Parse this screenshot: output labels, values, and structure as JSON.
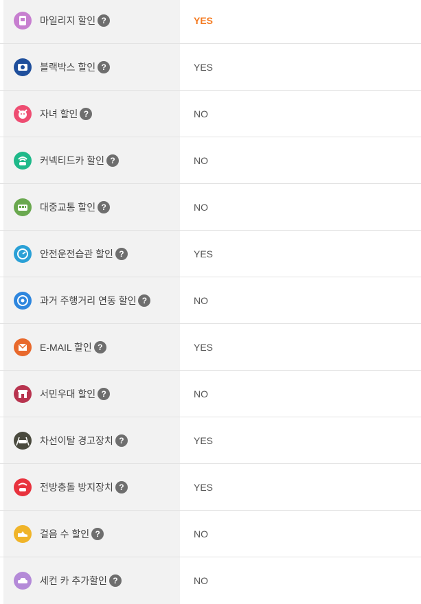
{
  "colors": {
    "highlight": "#f47a20",
    "label_bg": "#f2f2f2",
    "help_bg": "#6e6e6e"
  },
  "discounts": [
    {
      "label": "마일리지 할인",
      "value": "YES",
      "highlight": true,
      "icon": "mileage-icon",
      "color": "#c77fd0"
    },
    {
      "label": "블랙박스 할인",
      "value": "YES",
      "highlight": false,
      "icon": "blackbox-icon",
      "color": "#1f4f9c"
    },
    {
      "label": "자녀 할인",
      "value": "NO",
      "highlight": false,
      "icon": "child-icon",
      "color": "#ee4d72"
    },
    {
      "label": "커넥티드카 할인",
      "value": "NO",
      "highlight": false,
      "icon": "connected-car-icon",
      "color": "#1fb98a"
    },
    {
      "label": "대중교통 할인",
      "value": "NO",
      "highlight": false,
      "icon": "bus-icon",
      "color": "#6aa84f"
    },
    {
      "label": "안전운전습관 할인",
      "value": "YES",
      "highlight": false,
      "icon": "speedometer-icon",
      "color": "#2aa0d6"
    },
    {
      "label": "과거 주행거리 연동 할인",
      "value": "NO",
      "highlight": false,
      "icon": "odometer-icon",
      "color": "#2e86de"
    },
    {
      "label": "E-MAIL 할인",
      "value": "YES",
      "highlight": false,
      "icon": "email-icon",
      "color": "#e8692c"
    },
    {
      "label": "서민우대 할인",
      "value": "NO",
      "highlight": false,
      "icon": "store-icon",
      "color": "#b8344f"
    },
    {
      "label": "차선이탈 경고장치",
      "value": "YES",
      "highlight": false,
      "icon": "lane-departure-icon",
      "color": "#4a4a3e"
    },
    {
      "label": "전방충돌 방지장치",
      "value": "YES",
      "highlight": false,
      "icon": "collision-warning-icon",
      "color": "#e8333e"
    },
    {
      "label": "걸음 수 할인",
      "value": "NO",
      "highlight": false,
      "icon": "shoe-icon",
      "color": "#f0b429"
    },
    {
      "label": "세컨 카 추가할인",
      "value": "NO",
      "highlight": false,
      "icon": "second-car-icon",
      "color": "#b48ad8"
    }
  ],
  "help_symbol": "?"
}
